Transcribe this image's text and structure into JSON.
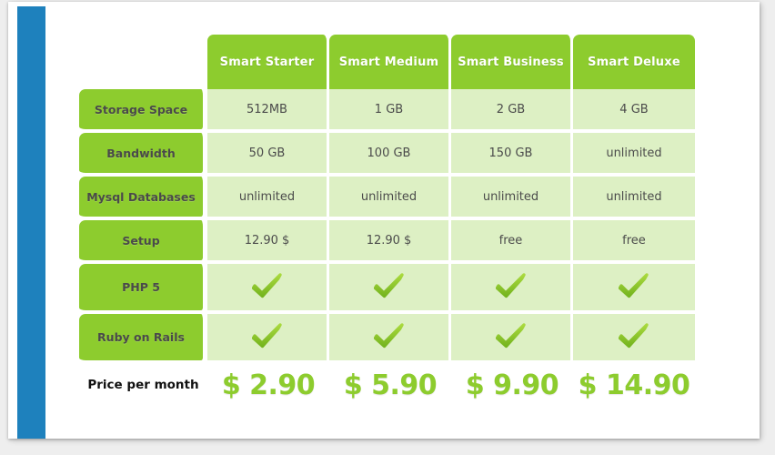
{
  "theme": {
    "rail_color": "#1e81bd",
    "header_green": "#8dcc2e",
    "cell_green": "#ddf0c4",
    "price_green": "#8dcc2e",
    "page_background": "#ffffff",
    "canvas_background": "#eeeeee"
  },
  "table": {
    "corner_label": "",
    "plans": [
      {
        "name": "Smart Starter"
      },
      {
        "name": "Smart Medium"
      },
      {
        "name": "Smart Business"
      },
      {
        "name": "Smart Deluxe"
      }
    ],
    "features": [
      {
        "label": "Storage Space",
        "type": "text",
        "values": [
          "512MB",
          "1 GB",
          "2 GB",
          "4 GB"
        ]
      },
      {
        "label": "Bandwidth",
        "type": "text",
        "values": [
          "50 GB",
          "100 GB",
          "150 GB",
          "unlimited"
        ]
      },
      {
        "label": "Mysql Databases",
        "type": "text",
        "values": [
          "unlimited",
          "unlimited",
          "unlimited",
          "unlimited"
        ]
      },
      {
        "label": "Setup",
        "type": "text",
        "values": [
          "12.90 $",
          "12.90 $",
          "free",
          "free"
        ]
      },
      {
        "label": "PHP 5",
        "type": "check",
        "values": [
          "check-icon",
          "check-icon",
          "check-icon",
          "check-icon"
        ]
      },
      {
        "label": "Ruby on Rails",
        "type": "check",
        "values": [
          "check-icon",
          "check-icon",
          "check-icon",
          "check-icon"
        ]
      }
    ],
    "price_row": {
      "label": "Price per month",
      "values": [
        "$ 2.90",
        "$ 5.90",
        "$ 9.90",
        "$ 14.90"
      ]
    }
  }
}
